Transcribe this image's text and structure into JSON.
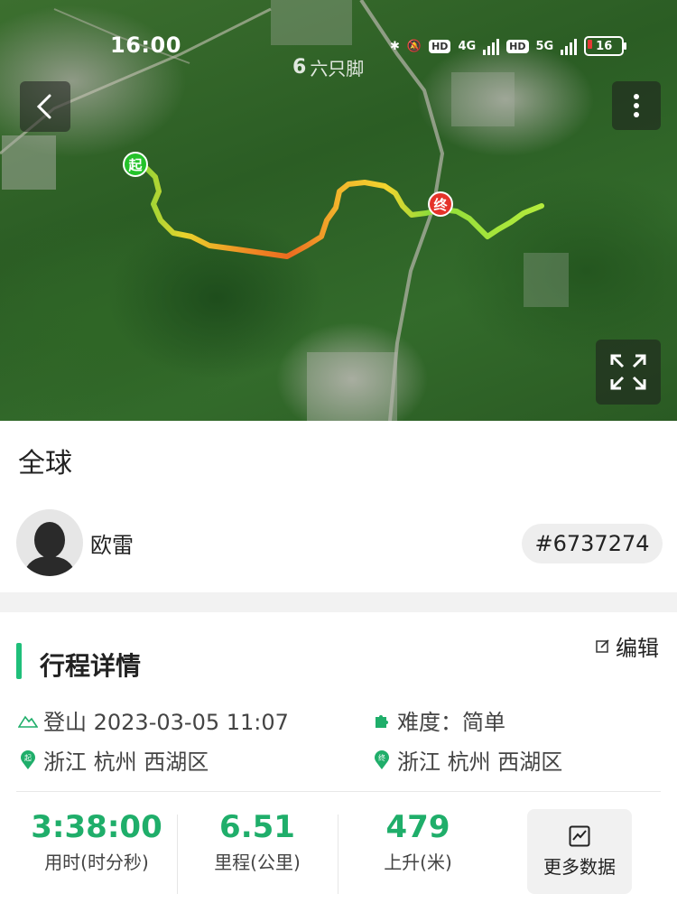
{
  "status_bar": {
    "time": "16:00",
    "network_1": "4G",
    "network_2": "5G",
    "hd_label": "HD",
    "battery": "16"
  },
  "map": {
    "watermark": "六只脚",
    "start_marker": "起",
    "end_marker": "终",
    "route_colors": [
      "#7fd63a",
      "#f2c22e",
      "#f08a24",
      "#e9621f"
    ]
  },
  "header": {
    "scope": "全球",
    "username": "欧雷",
    "track_id": "#6737274"
  },
  "trip": {
    "section_title": "行程详情",
    "edit_label": "编辑",
    "activity": "登山 2023-03-05 11:07",
    "difficulty": "难度：简单",
    "start_location": "浙江 杭州 西湖区",
    "end_location": "浙江 杭州 西湖区",
    "start_tag": "起",
    "end_tag": "终"
  },
  "stats": {
    "duration_value": "3:38:00",
    "duration_label": "用时(时分秒)",
    "distance_value": "6.51",
    "distance_label": "里程(公里)",
    "ascent_value": "479",
    "ascent_label": "上升(米)",
    "more_label": "更多数据"
  },
  "colors": {
    "accent": "#1fae6a",
    "start_pin": "#24c22a",
    "end_pin": "#e5332a"
  }
}
